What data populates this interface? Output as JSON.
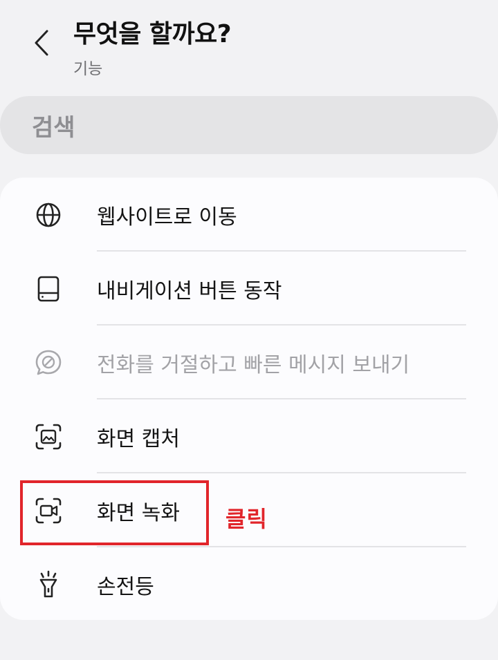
{
  "header": {
    "title": "무엇을 할까요?",
    "subtitle": "기능"
  },
  "search": {
    "label": "검색"
  },
  "items": [
    {
      "label": "웹사이트로 이동",
      "icon": "globe-icon",
      "enabled": true
    },
    {
      "label": "내비게이션 버튼 동작",
      "icon": "navigation-bar-icon",
      "enabled": true
    },
    {
      "label": "전화를 거절하고 빠른 메시지 보내기",
      "icon": "blocked-message-icon",
      "enabled": false
    },
    {
      "label": "화면 캡처",
      "icon": "screenshot-icon",
      "enabled": true
    },
    {
      "label": "화면 녹화",
      "icon": "screen-record-icon",
      "enabled": true
    },
    {
      "label": "손전등",
      "icon": "flashlight-icon",
      "enabled": true
    }
  ],
  "annotation": {
    "text": "클릭",
    "color": "#e1252b"
  },
  "colors": {
    "background": "#f2f2f4",
    "card": "#fcfcfe",
    "search_bg": "#e4e4e6",
    "disabled_text": "#a2a2a6"
  }
}
